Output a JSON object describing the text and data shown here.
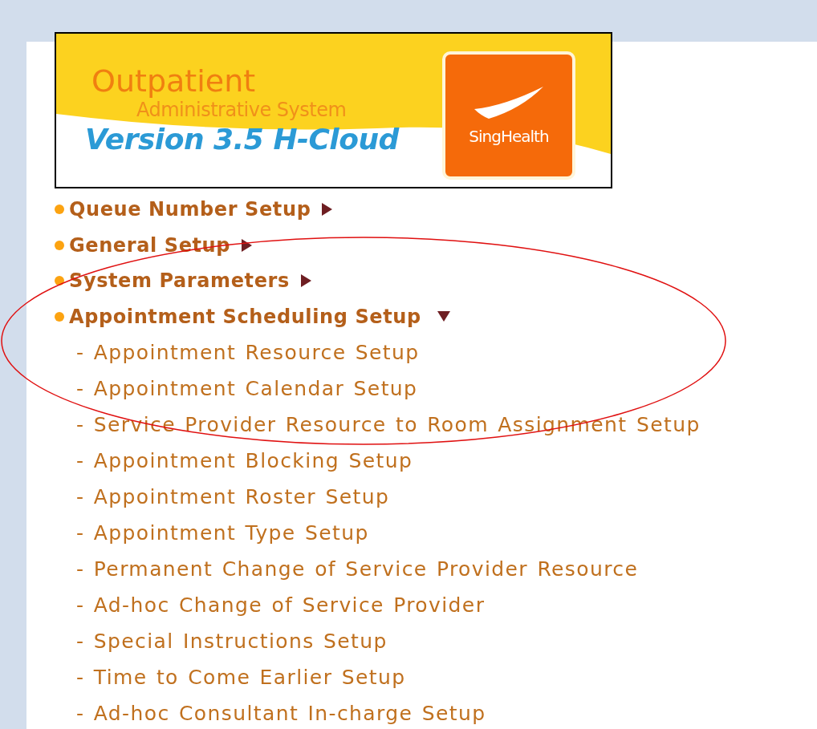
{
  "banner": {
    "title": "Outpatient",
    "subtitle": "Administrative System",
    "version": "Version 3.5 H-Cloud",
    "logo_text": "SingHealth"
  },
  "menu": [
    {
      "label": "Queue Number Setup",
      "expanded": false
    },
    {
      "label": "General Setup",
      "expanded": false
    },
    {
      "label": "System Parameters",
      "expanded": false
    },
    {
      "label": "Appointment Scheduling Setup",
      "expanded": true,
      "children": [
        {
          "label": "- Appointment Resource Setup"
        },
        {
          "label": "- Appointment Calendar Setup"
        },
        {
          "label": "- Service Provider Resource to Room Assignment Setup"
        },
        {
          "label": "- Appointment Blocking Setup"
        },
        {
          "label": "- Appointment Roster Setup"
        },
        {
          "label": "- Appointment Type Setup"
        },
        {
          "label": "- Permanent Change of Service Provider Resource"
        },
        {
          "label": "- Ad-hoc Change of Service Provider"
        },
        {
          "label": "- Special Instructions Setup"
        },
        {
          "label": "- Time to Come Earlier Setup"
        },
        {
          "label": "- Ad-hoc Consultant In-charge Setup"
        }
      ]
    }
  ],
  "annotation": {
    "kind": "ellipse",
    "color": "#e01010"
  }
}
